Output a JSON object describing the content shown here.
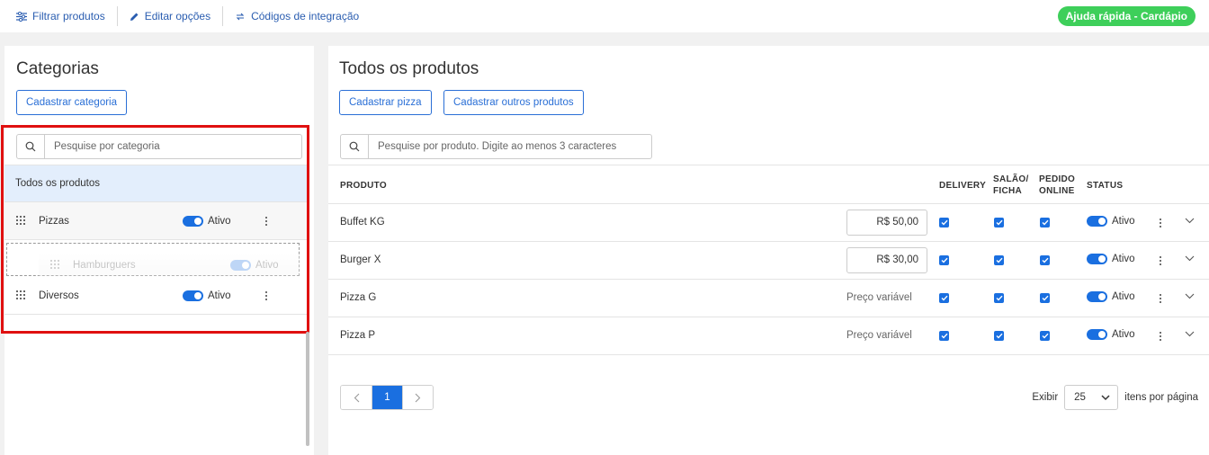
{
  "topbar": {
    "filter_label": "Filtrar produtos",
    "edit_label": "Editar opções",
    "codes_label": "Códigos de integração",
    "help_label": "Ajuda rápida - Cardápio"
  },
  "categories": {
    "title": "Categorias",
    "add_button": "Cadastrar categoria",
    "search_placeholder": "Pesquise por categoria",
    "all_label": "Todos os produtos",
    "items": [
      {
        "name": "Pizzas",
        "status": "Ativo"
      },
      {
        "name": "Hamburguers",
        "status": "Ativo"
      },
      {
        "name": "Diversos",
        "status": "Ativo"
      }
    ]
  },
  "products": {
    "title": "Todos os produtos",
    "add_pizza": "Cadastrar pizza",
    "add_other": "Cadastrar outros produtos",
    "search_placeholder": "Pesquise por produto. Digite ao menos 3 caracteres",
    "headers": {
      "product": "PRODUTO",
      "delivery": "DELIVERY",
      "salao_1": "SALÃO/",
      "salao_2": "FICHA",
      "pedido_1": "PEDIDO",
      "pedido_2": "ONLINE",
      "status": "STATUS"
    },
    "rows": [
      {
        "name": "Buffet KG",
        "price": "R$ 50,00",
        "delivery": true,
        "salao": true,
        "online": true,
        "status": "Ativo"
      },
      {
        "name": "Burger X",
        "price": "R$ 30,00",
        "delivery": true,
        "salao": true,
        "online": true,
        "status": "Ativo"
      },
      {
        "name": "Pizza G",
        "price": "Preço variável",
        "delivery": true,
        "salao": true,
        "online": true,
        "status": "Ativo"
      },
      {
        "name": "Pizza P",
        "price": "Preço variável",
        "delivery": true,
        "salao": true,
        "online": true,
        "status": "Ativo"
      }
    ]
  },
  "pagination": {
    "current_page": "1",
    "show_label": "Exibir",
    "per_page": "25",
    "per_page_suffix": "itens por página"
  },
  "colors": {
    "accent": "#1a6fe0",
    "help_green": "#3ecf5a",
    "highlight_red": "#e01010",
    "selected_row": "#e3eefc"
  },
  "icons": [
    "sliders-icon",
    "pencil-icon",
    "link-icon",
    "search-icon",
    "drag-handle-icon",
    "kebab-icon",
    "chevron-down-icon",
    "chevron-left-icon",
    "chevron-right-icon",
    "check-icon"
  ]
}
